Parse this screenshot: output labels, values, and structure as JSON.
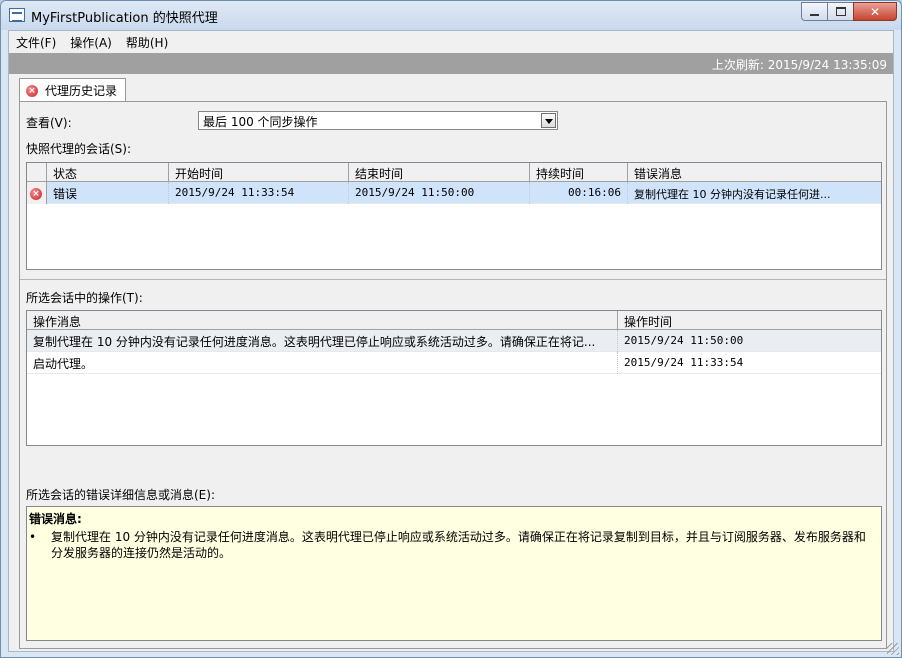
{
  "window": {
    "title": "MyFirstPublication 的快照代理",
    "caption_close": "✕"
  },
  "menu": [
    "文件(F)",
    "操作(A)",
    "帮助(H)"
  ],
  "refresh_text": "上次刷新: 2015/9/24 13:35:09",
  "tab": {
    "label": "代理历史记录",
    "icon": "error-icon"
  },
  "view": {
    "label": "查看(V):",
    "selected": "最后 100 个同步操作"
  },
  "sessions": {
    "label": "快照代理的会话(S):",
    "columns": [
      "状态",
      "开始时间",
      "结束时间",
      "持续时间",
      "错误消息"
    ],
    "rows": [
      {
        "status": "错误",
        "start": "2015/9/24 11:33:54",
        "end": "2015/9/24 11:50:00",
        "duration": "00:16:06",
        "message": "复制代理在 10 分钟内没有记录任何进..."
      }
    ]
  },
  "actions": {
    "label": "所选会话中的操作(T):",
    "columns": [
      "操作消息",
      "操作时间"
    ],
    "rows": [
      {
        "message": "复制代理在 10 分钟内没有记录任何进度消息。这表明代理已停止响应或系统活动过多。请确保正在将记...",
        "time": "2015/9/24 11:50:00"
      },
      {
        "message": "启动代理。",
        "time": "2015/9/24 11:33:54"
      }
    ]
  },
  "details": {
    "label": "所选会话的错误详细信息或消息(E):",
    "title": "错误消息:",
    "bullet": "•",
    "body": "复制代理在 10 分钟内没有记录任何进度消息。这表明代理已停止响应或系统活动过多。请确保正在将记录复制到目标，并且与订阅服务器、发布服务器和分发服务器的连接仍然是活动的。"
  }
}
